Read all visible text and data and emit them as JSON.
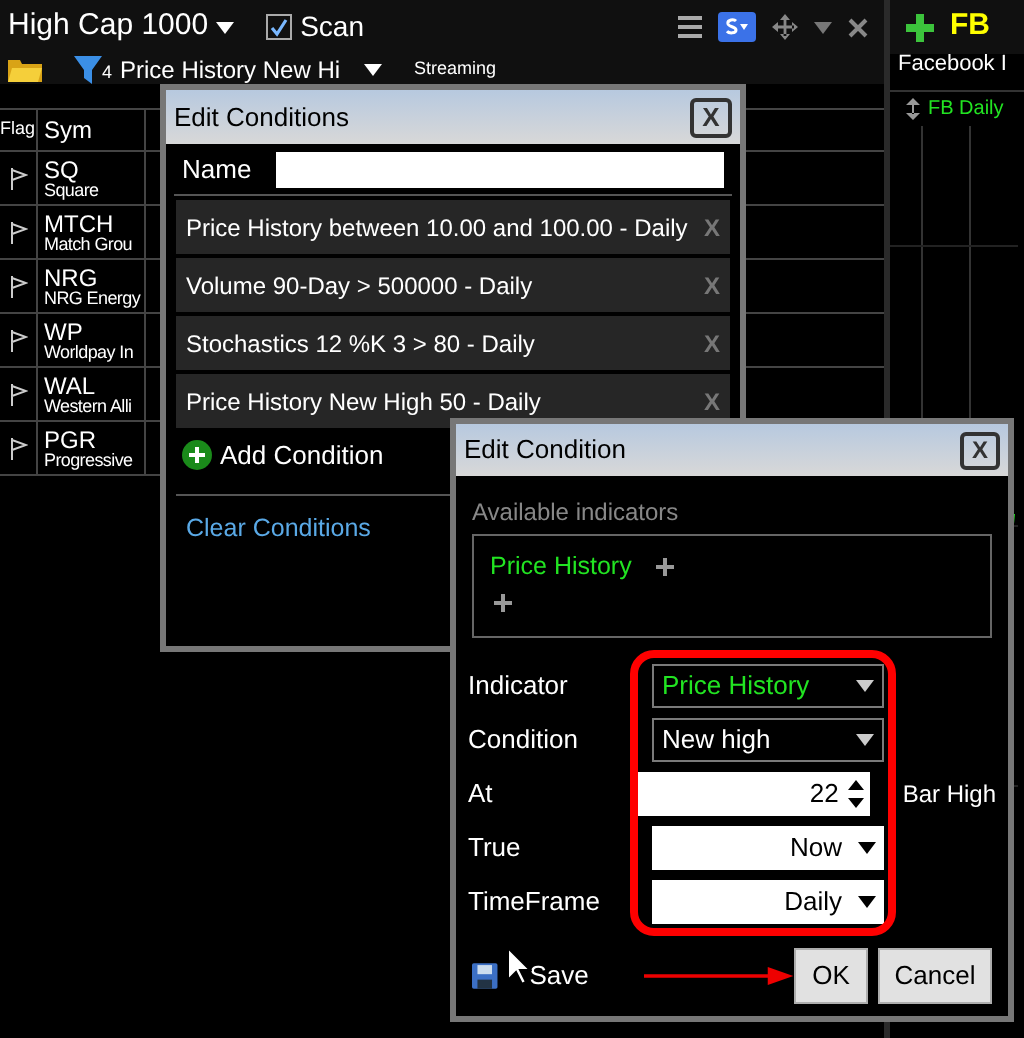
{
  "scanner": {
    "title": "High Cap 1000",
    "scan_label": "Scan",
    "scan_checked": true,
    "filter_count": "4",
    "filter_name": "Price History New Hi",
    "streaming_label": "Streaming",
    "columns": [
      "Flag",
      "Sym"
    ],
    "rows": [
      {
        "symbol": "SQ",
        "name": "Square"
      },
      {
        "symbol": "MTCH",
        "name": "Match Grou"
      },
      {
        "symbol": "NRG",
        "name": "NRG Energy"
      },
      {
        "symbol": "WP",
        "name": "Worldpay In"
      },
      {
        "symbol": "WAL",
        "name": "Western Alli"
      },
      {
        "symbol": "PGR",
        "name": "Progressive"
      }
    ]
  },
  "chart_panel": {
    "symbol": "FB",
    "company": "Facebook I",
    "chart_label": "FB Daily"
  },
  "edit_conditions": {
    "title": "Edit Conditions",
    "close": "X",
    "name_label": "Name",
    "conditions": [
      {
        "text": "Price History between 10.00 and 100.00 - Daily",
        "remove": "X"
      },
      {
        "text": "Volume 90-Day > 500000 - Daily",
        "remove": "X"
      },
      {
        "text": "Stochastics 12 %K 3 > 80 - Daily",
        "remove": "X"
      },
      {
        "text": "Price History New High 50 - Daily",
        "remove": "X"
      }
    ],
    "add_label": "Add Condition",
    "clear_label": "Clear Conditions"
  },
  "edit_condition": {
    "title": "Edit Condition",
    "close": "X",
    "available_label": "Available indicators",
    "indicators": [
      "Price History"
    ],
    "fields": [
      {
        "label": "Indicator",
        "kind": "dropdown",
        "value": "Price History",
        "highlight": true
      },
      {
        "label": "Condition",
        "kind": "dropdown",
        "value": "New high",
        "highlight": false
      },
      {
        "label": "At",
        "kind": "spinner",
        "value": "22",
        "suffix": "Bar High"
      },
      {
        "label": "True",
        "kind": "dropdown-light",
        "value": "Now"
      },
      {
        "label": "TimeFrame",
        "kind": "dropdown-light",
        "value": "Daily"
      }
    ],
    "save_label": "Save",
    "buttons": [
      "OK",
      "Cancel"
    ]
  }
}
